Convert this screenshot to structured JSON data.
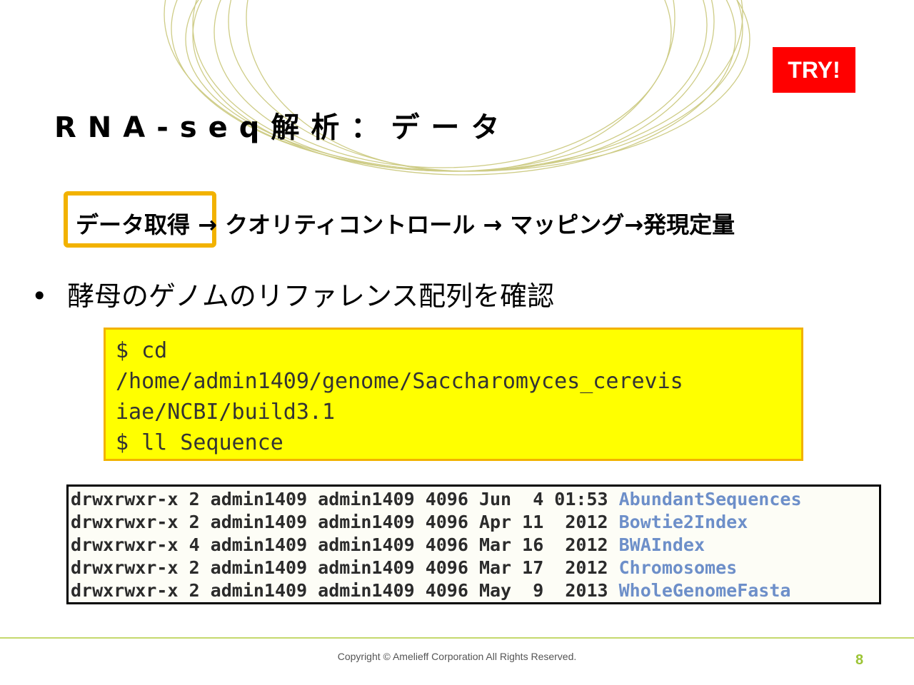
{
  "badge": {
    "label": "TRY!"
  },
  "title": "RNA-seq解析：データ",
  "workflow": {
    "current_step": "データ取得",
    "rest": " → クオリティコントロール → マッピング→発現定量"
  },
  "bullet": {
    "marker": "•",
    "text": "酵母のゲノムのリファレンス配列を確認"
  },
  "commands": [
    "$ cd",
    "/home/admin1409/genome/Saccharomyces_cerevis",
    "iae/NCBI/build3.1",
    "$ ll Sequence"
  ],
  "listing": [
    {
      "meta": "drwxrwxr-x 2 admin1409 admin1409 4096 Jun  4 01:53 ",
      "name": "AbundantSequences"
    },
    {
      "meta": "drwxrwxr-x 2 admin1409 admin1409 4096 Apr 11  2012 ",
      "name": "Bowtie2Index"
    },
    {
      "meta": "drwxrwxr-x 4 admin1409 admin1409 4096 Mar 16  2012 ",
      "name": "BWAIndex"
    },
    {
      "meta": "drwxrwxr-x 2 admin1409 admin1409 4096 Mar 17  2012 ",
      "name": "Chromosomes"
    },
    {
      "meta": "drwxrwxr-x 2 admin1409 admin1409 4096 May  9  2013 ",
      "name": "WholeGenomeFasta"
    }
  ],
  "footer": {
    "copyright": "Copyright © Amelieff Corporation All Rights Reserved.",
    "page": "8"
  },
  "colors": {
    "badge": "#ff0000",
    "highlight_border": "#f2b200",
    "command_bg": "#ffff00",
    "dir_name": "#6d8fc9",
    "accent": "#9cc435"
  }
}
